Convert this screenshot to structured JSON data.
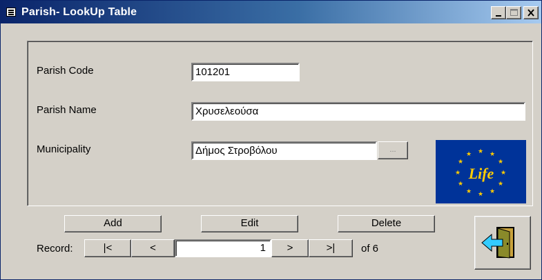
{
  "window": {
    "title": "Parish- LookUp Table",
    "controls": [
      "minimize",
      "maximize",
      "close"
    ]
  },
  "fields": {
    "parish_code": {
      "label": "Parish Code",
      "value": "101201"
    },
    "parish_name": {
      "label": "Parish Name",
      "value": "Χρυσελεούσα"
    },
    "municipality": {
      "label": "Municipality",
      "value": "Δήμος Στροβόλου",
      "browse_label": "..."
    }
  },
  "logo": {
    "text": "Life",
    "icon": "eu-life-logo"
  },
  "actions": {
    "add": "Add",
    "edit": "Edit",
    "delete": "Delete",
    "exit_icon": "exit-door-icon"
  },
  "navigator": {
    "label": "Record:",
    "first": "|<",
    "prev": "<",
    "current": "1",
    "next": ">",
    "last": ">|",
    "total": "of 6"
  },
  "colors": {
    "face": "#d4d0c8",
    "title_start": "#0a246a",
    "title_end": "#a6caf0",
    "logo_bg": "#003399",
    "logo_star": "#ffcc00"
  }
}
